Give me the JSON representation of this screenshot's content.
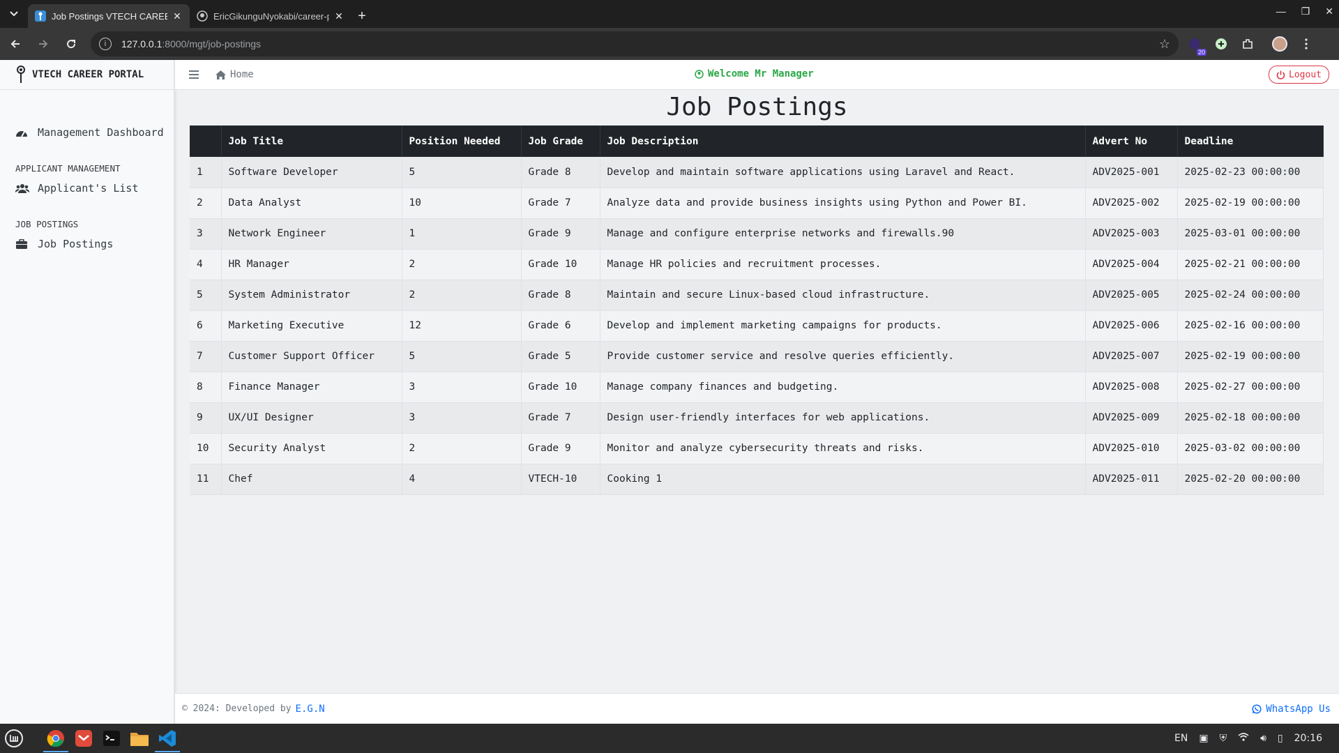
{
  "browser": {
    "tabs": [
      {
        "title": "Job Postings VTECH CAREER PORTAL",
        "active": true
      },
      {
        "title": "EricGikunguNyokabi/career-portal",
        "active": false
      }
    ],
    "url_host": "127.0.0.1",
    "url_path": ":8000/mgt/job-postings",
    "extension_badge": "20"
  },
  "sidebar": {
    "brand": "VTECH CAREER PORTAL",
    "items": [
      {
        "label": "Management Dashboard",
        "icon": "dashboard-icon"
      },
      {
        "heading": "APPLICANT MANAGEMENT"
      },
      {
        "label": "Applicant's List",
        "icon": "users-icon"
      },
      {
        "heading": "JOB POSTINGS"
      },
      {
        "label": "Job Postings",
        "icon": "briefcase-icon"
      }
    ]
  },
  "topnav": {
    "home": "Home",
    "welcome": "Welcome Mr Manager",
    "logout": "Logout"
  },
  "main": {
    "title": "Job Postings",
    "table": {
      "headers": [
        "",
        "Job Title",
        "Position Needed",
        "Job Grade",
        "Job Description",
        "Advert No",
        "Deadline"
      ],
      "rows": [
        [
          "1",
          "Software Developer",
          "5",
          "Grade 8",
          "Develop and maintain software applications using Laravel and React.",
          "ADV2025-001",
          "2025-02-23 00:00:00"
        ],
        [
          "2",
          "Data Analyst",
          "10",
          "Grade 7",
          "Analyze data and provide business insights using Python and Power BI.",
          "ADV2025-002",
          "2025-02-19 00:00:00"
        ],
        [
          "3",
          "Network Engineer",
          "1",
          "Grade 9",
          "Manage and configure enterprise networks and firewalls.90",
          "ADV2025-003",
          "2025-03-01 00:00:00"
        ],
        [
          "4",
          "HR Manager",
          "2",
          "Grade 10",
          "Manage HR policies and recruitment processes.",
          "ADV2025-004",
          "2025-02-21 00:00:00"
        ],
        [
          "5",
          "System Administrator",
          "2",
          "Grade 8",
          "Maintain and secure Linux-based cloud infrastructure.",
          "ADV2025-005",
          "2025-02-24 00:00:00"
        ],
        [
          "6",
          "Marketing Executive",
          "12",
          "Grade 6",
          "Develop and implement marketing campaigns for products.",
          "ADV2025-006",
          "2025-02-16 00:00:00"
        ],
        [
          "7",
          "Customer Support Officer",
          "5",
          "Grade 5",
          "Provide customer service and resolve queries efficiently.",
          "ADV2025-007",
          "2025-02-19 00:00:00"
        ],
        [
          "8",
          "Finance Manager",
          "3",
          "Grade 10",
          "Manage company finances and budgeting.",
          "ADV2025-008",
          "2025-02-27 00:00:00"
        ],
        [
          "9",
          "UX/UI Designer",
          "3",
          "Grade 7",
          "Design user-friendly interfaces for web applications.",
          "ADV2025-009",
          "2025-02-18 00:00:00"
        ],
        [
          "10",
          "Security Analyst",
          "2",
          "Grade 9",
          "Monitor and analyze cybersecurity threats and risks.",
          "ADV2025-010",
          "2025-03-02 00:00:00"
        ],
        [
          "11",
          "Chef",
          "4",
          "VTECH-10",
          "Cooking 1",
          "ADV2025-011",
          "2025-02-20 00:00:00"
        ]
      ]
    }
  },
  "footer": {
    "copyright": "© 2024: Developed by",
    "developer": "E.G.N",
    "whatsapp": "WhatsApp Us"
  },
  "taskbar": {
    "language": "EN",
    "time": "20:16"
  },
  "colors": {
    "accent_green": "#28a745",
    "danger": "#dc3545",
    "link": "#0d6efd",
    "table_header": "#212529"
  }
}
